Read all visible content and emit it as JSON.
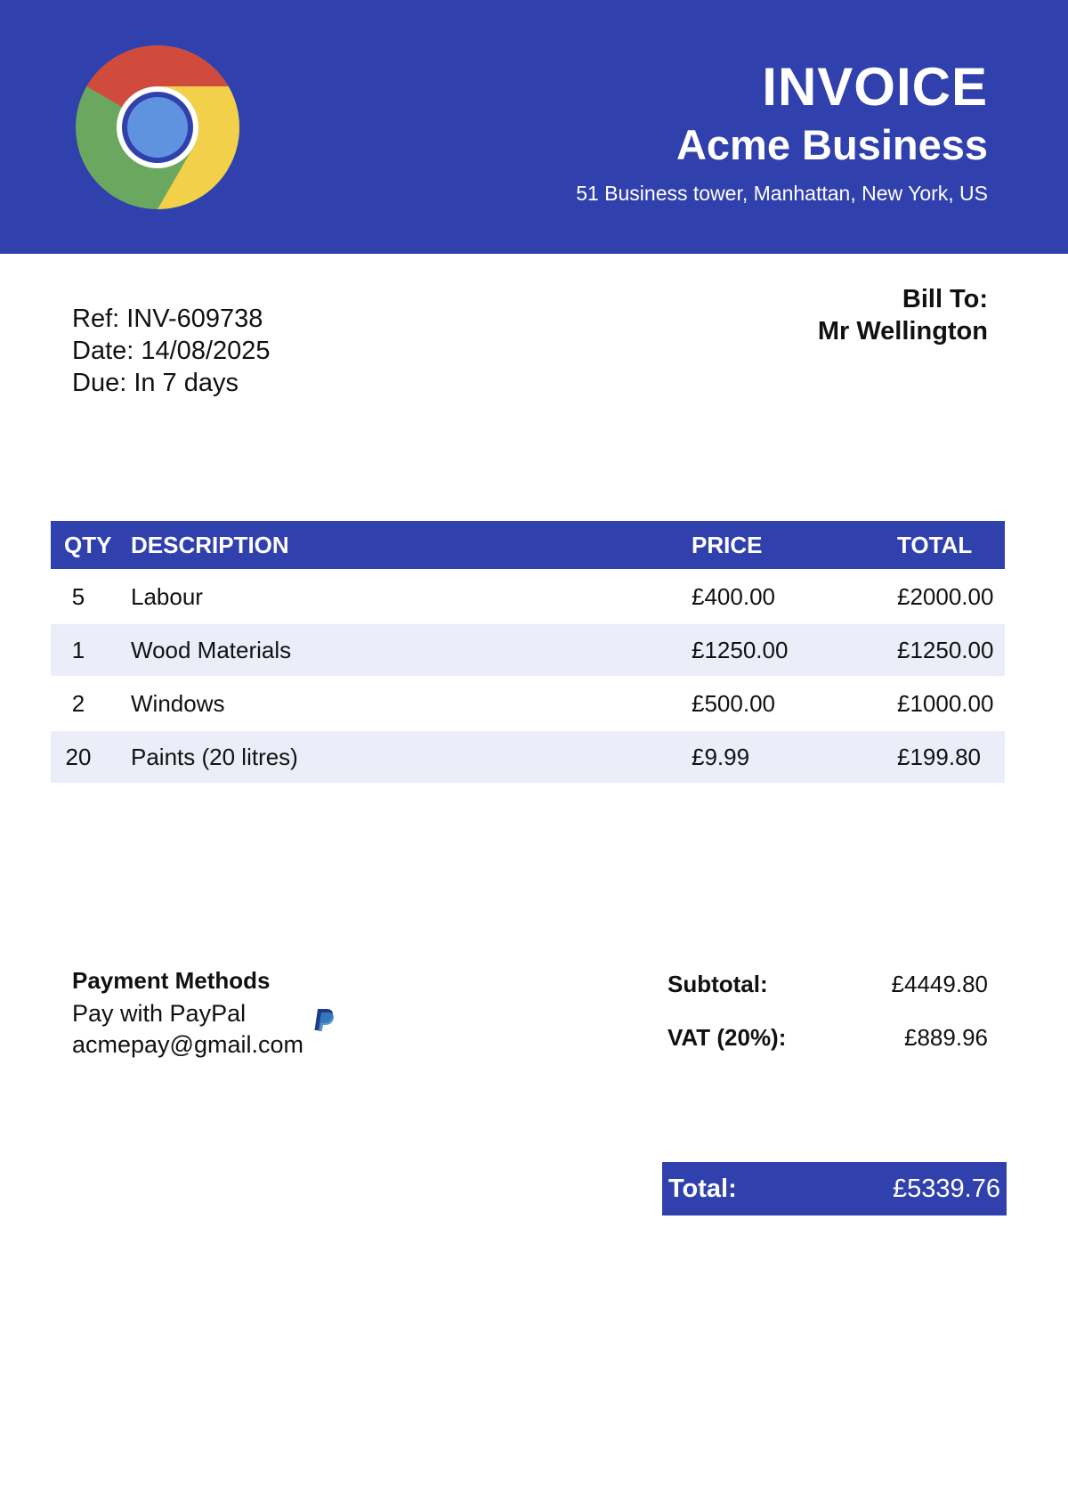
{
  "header": {
    "title": "INVOICE",
    "business_name": "Acme Business",
    "address": "51 Business tower, Manhattan, New York, US",
    "logo_icon": "chrome-logo-icon",
    "color": "#3040AC"
  },
  "invoice_meta": {
    "ref": "Ref: INV-609738",
    "date": "Date: 14/08/2025",
    "due": "Due: In 7 days"
  },
  "bill_to": {
    "label": "Bill To:",
    "name": "Mr Wellington"
  },
  "items_table": {
    "headers": {
      "qty": "QTY",
      "description": "DESCRIPTION",
      "price": "PRICE",
      "total": "TOTAL"
    },
    "rows": [
      {
        "qty": "5",
        "description": "Labour",
        "price": "£400.00",
        "total": "£2000.00"
      },
      {
        "qty": "1",
        "description": "Wood Materials",
        "price": "£1250.00",
        "total": "£1250.00"
      },
      {
        "qty": "2",
        "description": "Windows",
        "price": "£500.00",
        "total": "£1000.00"
      },
      {
        "qty": "20",
        "description": "Paints (20 litres)",
        "price": "£9.99",
        "total": "£199.80"
      }
    ],
    "stripe_color": "#EBEEF8"
  },
  "payment": {
    "title": "Payment Methods",
    "method": "Pay with PayPal",
    "email": "acmepay@gmail.com",
    "icon": "paypal-icon"
  },
  "summary": {
    "subtotal_label": "Subtotal:",
    "subtotal_value": "£4449.80",
    "vat_label": "VAT (20%):",
    "vat_value": "£889.96",
    "total_label": "Total:",
    "total_value": "£5339.76"
  }
}
